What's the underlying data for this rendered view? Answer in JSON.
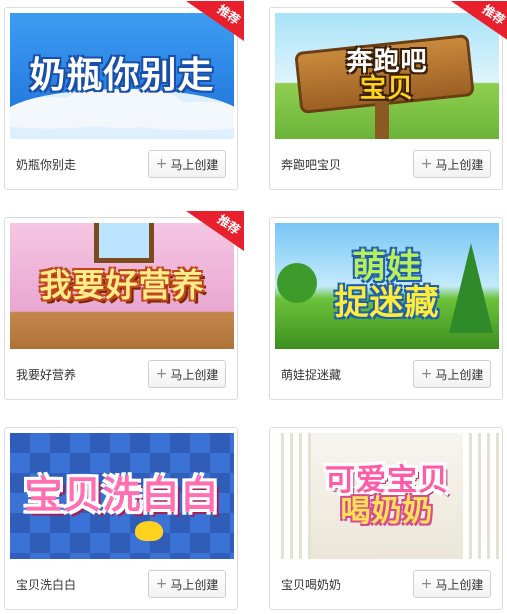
{
  "badge_label": "推荐",
  "create_label": "马上创建",
  "plus_icon": "plus-icon",
  "cards": [
    {
      "name": "奶瓶你别走",
      "thumb_lines": [
        "奶瓶你别走"
      ],
      "recommended": true
    },
    {
      "name": "奔跑吧宝贝",
      "thumb_lines": [
        "奔跑吧",
        "宝贝"
      ],
      "recommended": true
    },
    {
      "name": "我要好营养",
      "thumb_lines": [
        "我要好营养"
      ],
      "recommended": true
    },
    {
      "name": "萌娃捉迷藏",
      "thumb_lines": [
        "萌娃",
        "捉迷藏"
      ],
      "recommended": false
    },
    {
      "name": "宝贝洗白白",
      "thumb_lines": [
        "宝贝洗白白"
      ],
      "recommended": false
    },
    {
      "name": "宝贝喝奶奶",
      "thumb_lines": [
        "可爱宝贝",
        "喝奶奶"
      ],
      "recommended": false
    }
  ],
  "colors": {
    "badge": "#e8202e",
    "card_border": "#dcdcdc",
    "text": "#333333"
  }
}
